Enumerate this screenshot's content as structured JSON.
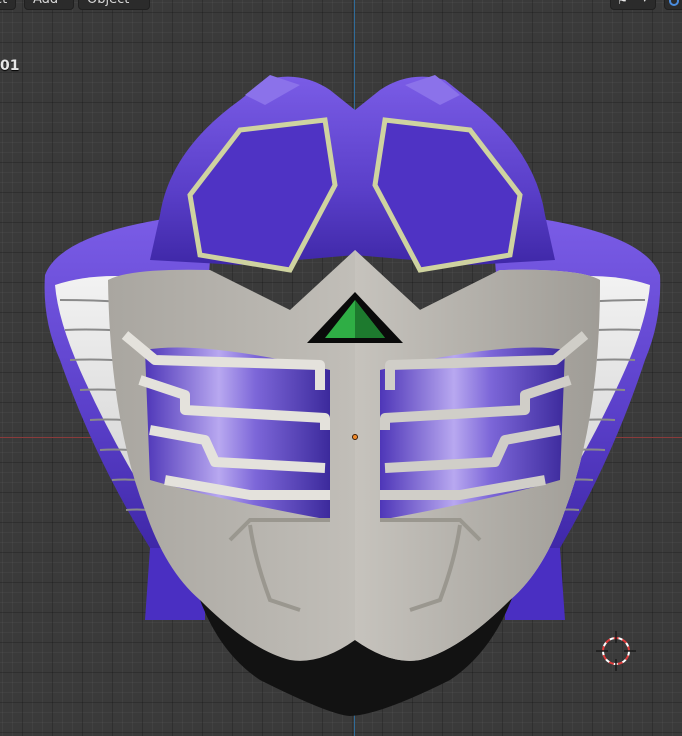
{
  "header": {
    "menu": {
      "select_label": "ct",
      "add_label": "Add",
      "object_label": "Object"
    },
    "overlay_label": "⚑",
    "overlay_caret": "▾"
  },
  "viewport": {
    "object_info": "01"
  },
  "colors": {
    "grid_bg": "#3a3a3a",
    "x_axis": "#8a3b3b",
    "z_axis": "#2f6c9a",
    "mask_purple": "#5a3fc9",
    "mask_silver": "#c9c6c0",
    "visor_green": "#2fae45",
    "origin": "#f08a2a"
  },
  "icons": {
    "overlay": "overlay-icon",
    "gizmo": "gizmo-icon",
    "cursor": "3d-cursor-icon",
    "origin": "object-origin-icon"
  }
}
